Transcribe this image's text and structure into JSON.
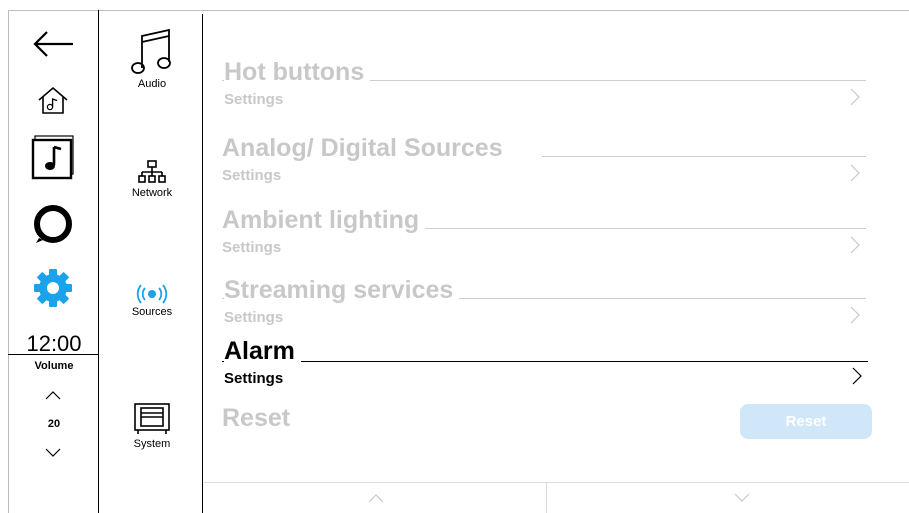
{
  "colors": {
    "accent": "#1aa3ea",
    "dim": "#c8c8c8",
    "reset_bg": "#cfe7f9"
  },
  "left_rail": {
    "icons": [
      "back-arrow-icon",
      "home-music-icon",
      "music-note-icon",
      "alexa-ring-icon",
      "gear-icon"
    ],
    "clock": "12:00",
    "volume_label": "Volume",
    "volume_value": "20"
  },
  "submenu": {
    "items": [
      {
        "label": "Audio",
        "icon": "music-notes-icon"
      },
      {
        "label": "Network",
        "icon": "network-icon"
      },
      {
        "label": "Sources",
        "icon": "broadcast-icon",
        "active": true
      },
      {
        "label": "System",
        "icon": "system-device-icon"
      }
    ]
  },
  "rows": [
    {
      "title": "Hot buttons",
      "subtitle": "Settings",
      "state": "dim"
    },
    {
      "title": "Analog/ Digital Sources",
      "subtitle": "Settings",
      "state": "dim"
    },
    {
      "title": "Ambient lighting",
      "subtitle": "Settings",
      "state": "dim"
    },
    {
      "title": "Streaming services",
      "subtitle": "Settings",
      "state": "dim"
    },
    {
      "title": "Alarm",
      "subtitle": "Settings",
      "state": "active"
    }
  ],
  "reset": {
    "title": "Reset",
    "button_label": "Reset"
  }
}
